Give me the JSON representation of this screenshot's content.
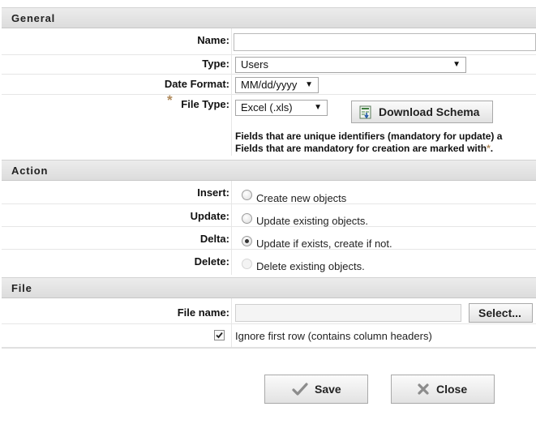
{
  "general": {
    "header": "General",
    "name_label": "Name:",
    "name_value": "",
    "type_label": "Type:",
    "type_value": "Users",
    "date_format_label": "Date Format:",
    "date_format_value": "MM/dd/yyyy",
    "required_marker": "*",
    "file_type_label": "File Type:",
    "file_type_value": "Excel (.xls)",
    "download_schema_label": "Download Schema",
    "note_line1": "Fields that are unique identifiers (mandatory for update) a",
    "note_line2": "Fields that are mandatory for creation are marked with",
    "note_star": "*",
    "note_end": "."
  },
  "action": {
    "header": "Action",
    "rows": [
      {
        "label": "Insert:",
        "option": "Create new objects",
        "checked": false,
        "disabled": false
      },
      {
        "label": "Update:",
        "option": "Update existing objects.",
        "checked": false,
        "disabled": false
      },
      {
        "label": "Delta:",
        "option": "Update if exists, create if not.",
        "checked": true,
        "disabled": false
      },
      {
        "label": "Delete:",
        "option": "Delete existing objects.",
        "checked": false,
        "disabled": true
      }
    ]
  },
  "file": {
    "header": "File",
    "file_name_label": "File name:",
    "file_name_value": "",
    "select_label": "Select...",
    "ignore_first_row_label": "Ignore first row (contains column headers)",
    "ignore_first_row_checked": true
  },
  "footer": {
    "save_label": "Save",
    "close_label": "Close"
  },
  "colors": {
    "required_star": "#b08a5c",
    "header_bg": "#e4e4e4"
  }
}
